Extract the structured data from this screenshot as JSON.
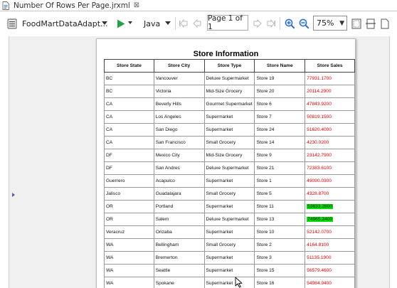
{
  "tab": {
    "title": "Number Of Rows Per Page.jrxml",
    "close_glyph": "⊠",
    "icon": "report-file-icon"
  },
  "toolbar": {
    "datasource_label": "FoodMartDataAdapt...",
    "language_label": "Java",
    "page_indicator": "Page 1 of 1",
    "zoom_value": "75%",
    "icons": [
      "datasource-icon",
      "run-icon",
      "first-page-icon",
      "prev-page-icon",
      "next-page-icon",
      "last-page-icon",
      "zoom-in-icon",
      "zoom-out-icon",
      "fit-page-icon",
      "fit-width-icon",
      "actual-size-icon"
    ],
    "colors": {
      "run": "#22a34a",
      "zoom": "#2b6cc4"
    }
  },
  "report": {
    "title": "Store Information",
    "columns": [
      "Store State",
      "Store City",
      "Store Type",
      "Store Name",
      "Store Sales"
    ],
    "rows": [
      [
        "BC",
        "Vancouver",
        "Deluxe Supermarket",
        "Store 19",
        "77931.1700",
        false
      ],
      [
        "BC",
        "Victoria",
        "Mid-Size Grocery",
        "Store 20",
        "20114.2900",
        false
      ],
      [
        "CA",
        "Beverly Hills",
        "Gourmet Supermarket",
        "Store 6",
        "47843.9200",
        false
      ],
      [
        "CA",
        "Los Angeles",
        "Supermarket",
        "Store 7",
        "50819.1500",
        false
      ],
      [
        "CA",
        "San Diego",
        "Supermarket",
        "Store 24",
        "51620.4000",
        false
      ],
      [
        "CA",
        "San Francisco",
        "Small Grocery",
        "Store 14",
        "4230.0200",
        false
      ],
      [
        "DF",
        "Mexico City",
        "Mid-Size Grocery",
        "Store 9",
        "23142.7900",
        false
      ],
      [
        "DF",
        "San Andres",
        "Deluxe Supermarket",
        "Store 21",
        "72383.6100",
        false
      ],
      [
        "Guerrero",
        "Acapulco",
        "Supermarket",
        "Store 1",
        "49090.0300",
        false
      ],
      [
        "Jalisco",
        "Guadalajara",
        "Small Grocery",
        "Store 5",
        "4328.8700",
        false
      ],
      [
        "OR",
        "Portland",
        "Supermarket",
        "Store 11",
        "53633.2800",
        true
      ],
      [
        "OR",
        "Salem",
        "Deluxe Supermarket",
        "Store 13",
        "74965.2400",
        true
      ],
      [
        "Veracruz",
        "Orizaba",
        "Supermarket",
        "Store 10",
        "52142.0700",
        false
      ],
      [
        "WA",
        "Bellingham",
        "Small Grocery",
        "Store 2",
        "4164.8100",
        false
      ],
      [
        "WA",
        "Bremerton",
        "Supermarket",
        "Store 3",
        "51135.1900",
        false
      ],
      [
        "WA",
        "Seattle",
        "Supermarket",
        "Store 15",
        "56579.4600",
        false
      ],
      [
        "WA",
        "Spokane",
        "Supermarket",
        "Store 16",
        "54984.9400",
        false
      ]
    ],
    "colors": {
      "sales_text": "#e00000",
      "highlight": "#00e000"
    }
  }
}
